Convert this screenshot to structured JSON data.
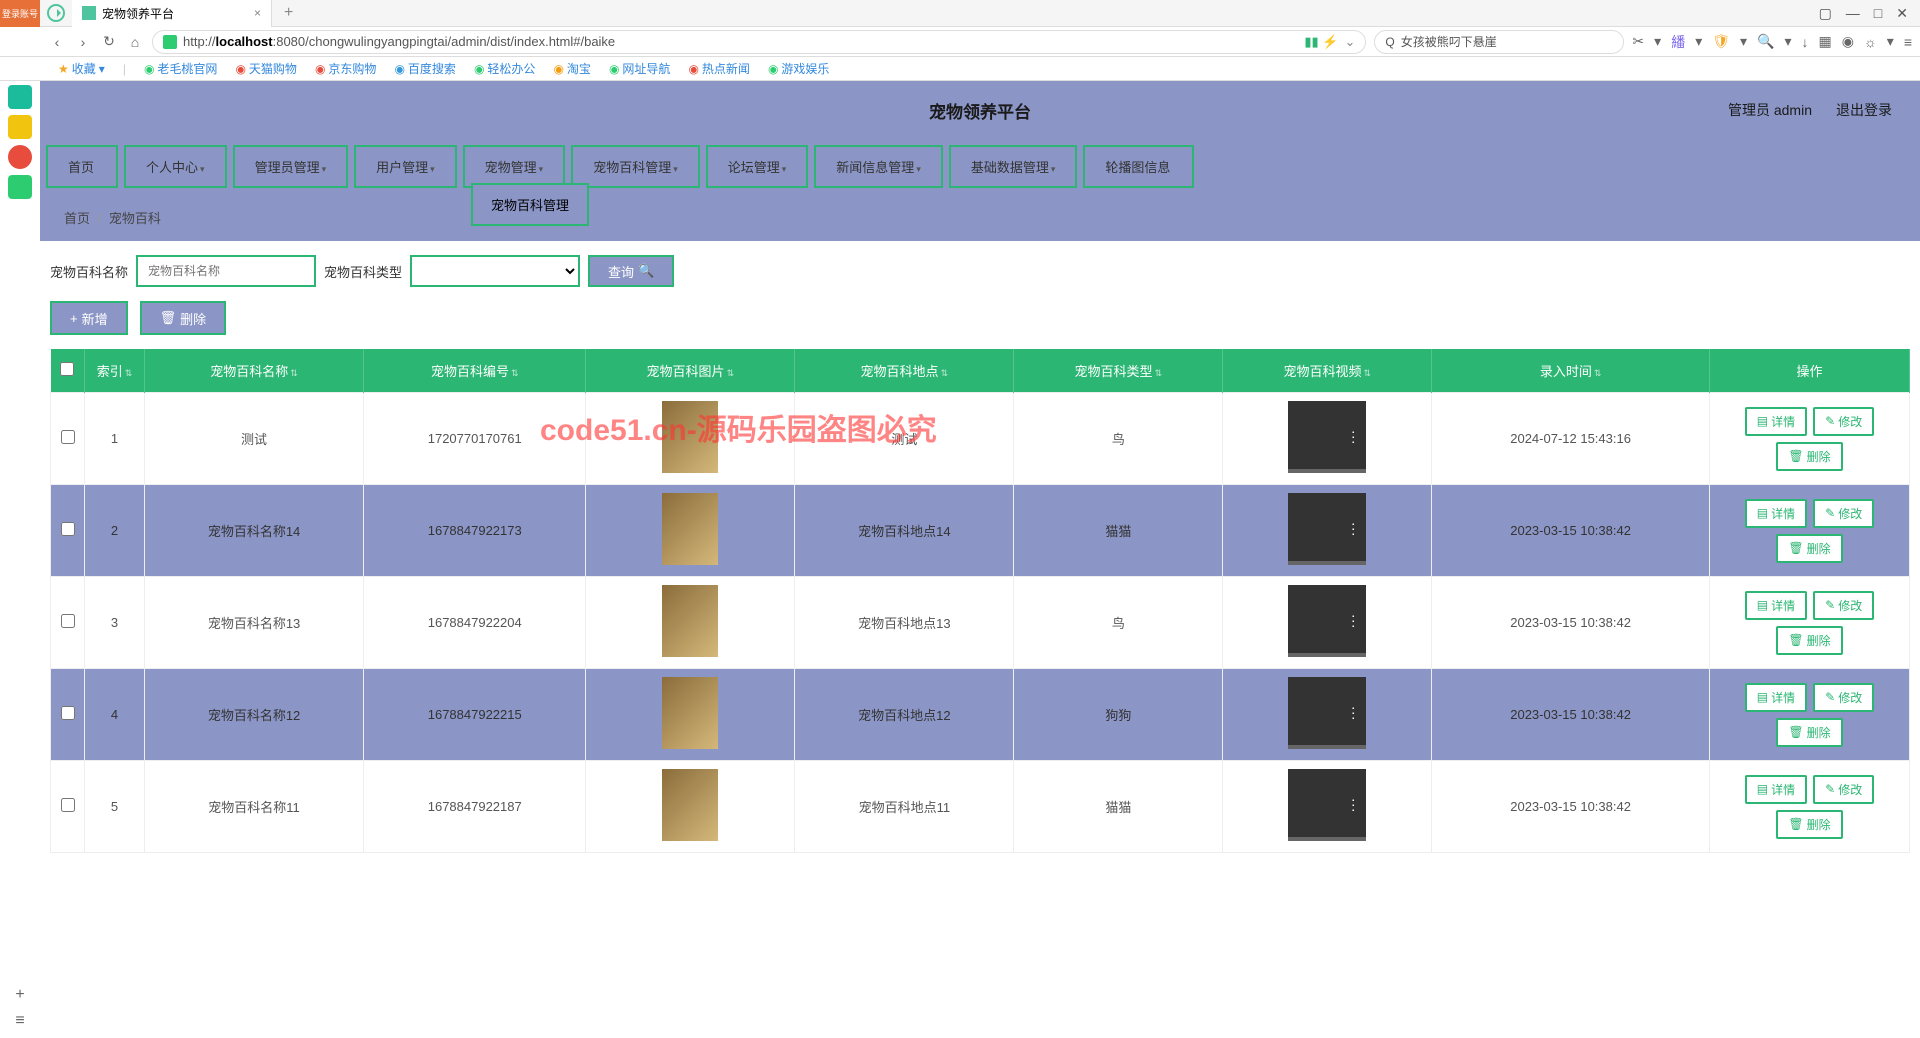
{
  "browser": {
    "login_badge": "登录账号",
    "tab_title": "宠物领养平台",
    "url_prefix": "http://",
    "url_host": "localhost",
    "url_rest": ":8080/chongwulingyangpingtai/admin/dist/index.html#/baike",
    "search_placeholder": "女孩被熊叼下悬崖",
    "bookmarks": {
      "fav": "收藏",
      "items": [
        "老毛桃官网",
        "天猫购物",
        "京东购物",
        "百度搜索",
        "轻松办公",
        "淘宝",
        "网址导航",
        "热点新闻",
        "游戏娱乐"
      ]
    }
  },
  "header": {
    "title": "宠物领养平台",
    "admin": "管理员 admin",
    "logout": "退出登录"
  },
  "nav": {
    "items": [
      "首页",
      "个人中心",
      "管理员管理",
      "用户管理",
      "宠物管理",
      "宠物百科管理",
      "论坛管理",
      "新闻信息管理",
      "基础数据管理",
      "轮播图信息"
    ],
    "dropdown": "宠物百科管理"
  },
  "breadcrumb": {
    "home": "首页",
    "current": "宠物百科"
  },
  "filters": {
    "name_label": "宠物百科名称",
    "name_placeholder": "宠物百科名称",
    "type_label": "宠物百科类型",
    "query": "查询"
  },
  "actions": {
    "add": "新增",
    "delete": "删除"
  },
  "table": {
    "headers": [
      "",
      "索引",
      "宠物百科名称",
      "宠物百科编号",
      "宠物百科图片",
      "宠物百科地点",
      "宠物百科类型",
      "宠物百科视频",
      "录入时间",
      "操作"
    ],
    "row_actions": {
      "detail": "详情",
      "edit": "修改",
      "delete": "删除"
    },
    "rows": [
      {
        "idx": "1",
        "name": "测试",
        "code": "1720770170761",
        "place": "测试",
        "type": "鸟",
        "time": "2024-07-12 15:43:16",
        "alt": false
      },
      {
        "idx": "2",
        "name": "宠物百科名称14",
        "code": "1678847922173",
        "place": "宠物百科地点14",
        "type": "猫猫",
        "time": "2023-03-15 10:38:42",
        "alt": true
      },
      {
        "idx": "3",
        "name": "宠物百科名称13",
        "code": "1678847922204",
        "place": "宠物百科地点13",
        "type": "鸟",
        "time": "2023-03-15 10:38:42",
        "alt": false
      },
      {
        "idx": "4",
        "name": "宠物百科名称12",
        "code": "1678847922215",
        "place": "宠物百科地点12",
        "type": "狗狗",
        "time": "2023-03-15 10:38:42",
        "alt": true
      },
      {
        "idx": "5",
        "name": "宠物百科名称11",
        "code": "1678847922187",
        "place": "宠物百科地点11",
        "type": "猫猫",
        "time": "2023-03-15 10:38:42",
        "alt": false
      }
    ]
  },
  "watermark": "code51.cn-源码乐园盗图必究"
}
